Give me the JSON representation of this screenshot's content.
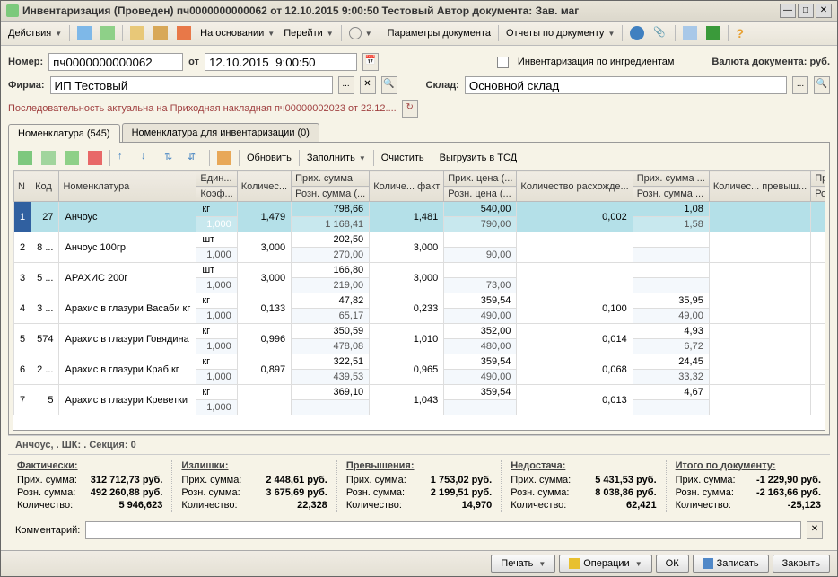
{
  "window": {
    "title": "Инвентаризация (Проведен)  пч0000000000062 от 12.10.2015 9:00:50 Тестовый Автор документа: Зав. маг"
  },
  "toolbar": {
    "actions": "Действия",
    "based_on": "На основании",
    "goto": "Перейти",
    "params": "Параметры документа",
    "reports": "Отчеты по документу"
  },
  "form": {
    "number_label": "Номер:",
    "number": "пч0000000000062",
    "from_label": "от",
    "date": "12.10.2015  9:00:50",
    "inv_by_ingredients": "Инвентаризация по ингредиентам",
    "currency_label": "Валюта документа: руб.",
    "firm_label": "Фирма:",
    "firm": "ИП Тестовый",
    "warehouse_label": "Склад:",
    "warehouse": "Основной склад",
    "sequence": "Последовательность актуальна на Приходная накладная пч00000002023 от 22.12...."
  },
  "tabs": {
    "t1": "Номенклатура (545)",
    "t2": "Номенклатура для инвентаризации (0)"
  },
  "tbl_tb": {
    "refresh": "Обновить",
    "fill": "Заполнить",
    "clear": "Очистить",
    "export": "Выгрузить в ТСД"
  },
  "headers": {
    "n": "N",
    "code": "Код",
    "nomen": "Номенклатура",
    "unit": "Един...",
    "koef": "Коэф...",
    "qty": "Количес...",
    "psum": "Прих. сумма",
    "rsum": "Розн. сумма (...",
    "qfact": "Количе... факт",
    "pprice": "Прих. цена (...",
    "rprice": "Розн. цена (...",
    "qdiff": "Количество расхожде...",
    "psum2": "Прих. сумма ...",
    "rsum2": "Розн. сумма ...",
    "qover": "Количес... превыш...",
    "psumover": "Прих. сумма превы...",
    "rsumover": "Розн. сумма превы..."
  },
  "rows": [
    {
      "n": "1",
      "code": "27",
      "nomen": "Анчоус",
      "unit": "кг",
      "koef": "1,000",
      "qty": "1,479",
      "psum": "798,66",
      "rsum": "1 168,41",
      "qfact": "1,481",
      "pprice": "540,00",
      "rprice": "790,00",
      "qdiff": "0,002",
      "psum2": "1,08",
      "rsum2": "1,58",
      "sel": true
    },
    {
      "n": "2",
      "code": "8 ...",
      "nomen": "Анчоус 100гр",
      "unit": "шт",
      "koef": "1,000",
      "qty": "3,000",
      "psum": "202,50",
      "rsum": "270,00",
      "qfact": "3,000",
      "pprice": "",
      "rprice": "90,00",
      "qdiff": "",
      "psum2": "",
      "rsum2": ""
    },
    {
      "n": "3",
      "code": "5 ...",
      "nomen": "АРАХИС 200г",
      "unit": "шт",
      "koef": "1,000",
      "qty": "3,000",
      "psum": "166,80",
      "rsum": "219,00",
      "qfact": "3,000",
      "pprice": "",
      "rprice": "73,00",
      "qdiff": "",
      "psum2": "",
      "rsum2": ""
    },
    {
      "n": "4",
      "code": "3 ...",
      "nomen": "Арахис в глазури Васаби кг",
      "unit": "кг",
      "koef": "1,000",
      "qty": "0,133",
      "psum": "47,82",
      "rsum": "65,17",
      "qfact": "0,233",
      "pprice": "359,54",
      "rprice": "490,00",
      "qdiff": "0,100",
      "psum2": "35,95",
      "rsum2": "49,00"
    },
    {
      "n": "5",
      "code": "574",
      "nomen": "Арахис в глазури Говядина",
      "unit": "кг",
      "koef": "1,000",
      "qty": "0,996",
      "psum": "350,59",
      "rsum": "478,08",
      "qfact": "1,010",
      "pprice": "352,00",
      "rprice": "480,00",
      "qdiff": "0,014",
      "psum2": "4,93",
      "rsum2": "6,72"
    },
    {
      "n": "6",
      "code": "2 ...",
      "nomen": "Арахис в глазури Краб кг",
      "unit": "кг",
      "koef": "1,000",
      "qty": "0,897",
      "psum": "322,51",
      "rsum": "439,53",
      "qfact": "0,965",
      "pprice": "359,54",
      "rprice": "490,00",
      "qdiff": "0,068",
      "psum2": "24,45",
      "rsum2": "33,32"
    },
    {
      "n": "7",
      "code": "5",
      "nomen": "Арахис в глазури Креветки",
      "unit": "кг",
      "koef": "1,000",
      "qty": "",
      "psum": "369,10",
      "rsum": "",
      "qfact": "1,043",
      "pprice": "359,54",
      "rprice": "",
      "qdiff": "0,013",
      "psum2": "4,67",
      "rsum2": ""
    }
  ],
  "footer_info": "Анчоус, . ШК: . Секция:  0",
  "totals": {
    "fact": {
      "hdr": "Фактически:",
      "psum": "312 712,73 руб.",
      "rsum": "492 260,88 руб.",
      "qty": "5 946,623"
    },
    "surplus": {
      "hdr": "Излишки:",
      "psum": "2 448,61 руб.",
      "rsum": "3 675,69 руб.",
      "qty": "22,328"
    },
    "over": {
      "hdr": "Превышения:",
      "psum": "1 753,02 руб.",
      "rsum": "2 199,51 руб.",
      "qty": "14,970"
    },
    "short": {
      "hdr": "Недостача:",
      "psum": "5 431,53 руб.",
      "rsum": "8 038,86 руб.",
      "qty": "62,421"
    },
    "doc": {
      "hdr": "Итого по документу:",
      "psum": "-1 229,90 руб.",
      "rsum": "-2 163,66 руб.",
      "qty": "-25,123"
    },
    "labels": {
      "psum": "Прих. сумма:",
      "rsum": "Розн. сумма:",
      "qty": "Количество:"
    }
  },
  "comment_label": "Комментарий:",
  "bottom": {
    "print": "Печать",
    "ops": "Операции",
    "ok": "ОК",
    "save": "Записать",
    "close": "Закрыть"
  }
}
